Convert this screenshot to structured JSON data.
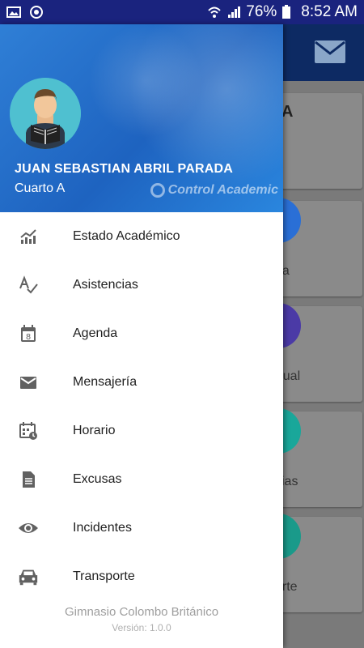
{
  "status_bar": {
    "battery": "76%",
    "time": "8:52 AM",
    "icons": [
      "image-icon",
      "power-icon",
      "wifi-icon",
      "signal-icon",
      "battery-icon"
    ]
  },
  "background_app": {
    "toolbar_color": "#0d2a63",
    "cards": [
      {
        "label": "A",
        "circle_color": ""
      },
      {
        "label": "da",
        "circle_color": "#2a6fd6"
      },
      {
        "label": "rtual",
        "circle_color": "#4b3aa6"
      },
      {
        "label": "cias",
        "circle_color": "#19a79a"
      },
      {
        "label": "orte",
        "circle_color": "#1a9a8a"
      }
    ]
  },
  "drawer": {
    "header": {
      "user_name": "JUAN SEBASTIAN ABRIL PARADA",
      "user_grade": "Cuarto A",
      "brand": "Control Academic"
    },
    "menu": [
      {
        "label": "Estado Académico",
        "icon": "trending-up-icon"
      },
      {
        "label": "Asistencias",
        "icon": "spellcheck-icon"
      },
      {
        "label": "Agenda",
        "icon": "calendar-icon"
      },
      {
        "label": "Mensajería",
        "icon": "mail-icon"
      },
      {
        "label": "Horario",
        "icon": "schedule-icon"
      },
      {
        "label": "Excusas",
        "icon": "document-icon"
      },
      {
        "label": "Incidentes",
        "icon": "eye-icon"
      },
      {
        "label": "Transporte",
        "icon": "car-icon"
      }
    ],
    "footer": {
      "school": "Gimnasio Colombo Británico",
      "version": "Versión: 1.0.0"
    }
  },
  "colors": {
    "accent": "#1e63c0",
    "status_bar": "#1a237e",
    "icon_gray": "#616161"
  }
}
